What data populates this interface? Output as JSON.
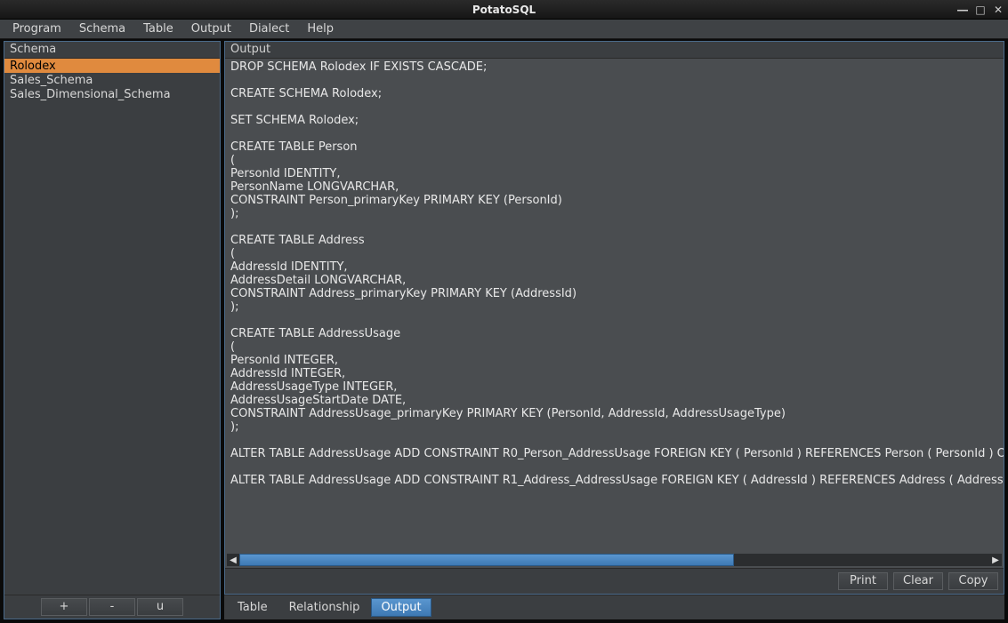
{
  "window": {
    "title": "PotatoSQL"
  },
  "menubar": [
    "Program",
    "Schema",
    "Table",
    "Output",
    "Dialect",
    "Help"
  ],
  "sidebar": {
    "header": "Schema",
    "items": [
      {
        "label": "Rolodex",
        "selected": true
      },
      {
        "label": "Sales_Schema",
        "selected": false
      },
      {
        "label": "Sales_Dimensional_Schema",
        "selected": false
      }
    ],
    "buttons": {
      "add": "+",
      "remove": "-",
      "update": "u"
    }
  },
  "output": {
    "header": "Output",
    "text": "DROP SCHEMA Rolodex IF EXISTS CASCADE;\n\nCREATE SCHEMA Rolodex;\n\nSET SCHEMA Rolodex;\n\nCREATE TABLE Person\n(\nPersonId IDENTITY,\nPersonName LONGVARCHAR,\nCONSTRAINT Person_primaryKey PRIMARY KEY (PersonId)\n);\n\nCREATE TABLE Address\n(\nAddressId IDENTITY,\nAddressDetail LONGVARCHAR,\nCONSTRAINT Address_primaryKey PRIMARY KEY (AddressId)\n);\n\nCREATE TABLE AddressUsage\n(\nPersonId INTEGER,\nAddressId INTEGER,\nAddressUsageType INTEGER,\nAddressUsageStartDate DATE,\nCONSTRAINT AddressUsage_primaryKey PRIMARY KEY (PersonId, AddressId, AddressUsageType)\n);\n\nALTER TABLE AddressUsage ADD CONSTRAINT R0_Person_AddressUsage FOREIGN KEY ( PersonId ) REFERENCES Person ( PersonId ) ON DE\n\nALTER TABLE AddressUsage ADD CONSTRAINT R1_Address_AddressUsage FOREIGN KEY ( AddressId ) REFERENCES Address ( AddressId ) O",
    "actions": {
      "print": "Print",
      "clear": "Clear",
      "copy": "Copy"
    }
  },
  "tabs": [
    {
      "label": "Table",
      "active": false
    },
    {
      "label": "Relationship",
      "active": false
    },
    {
      "label": "Output",
      "active": true
    }
  ]
}
